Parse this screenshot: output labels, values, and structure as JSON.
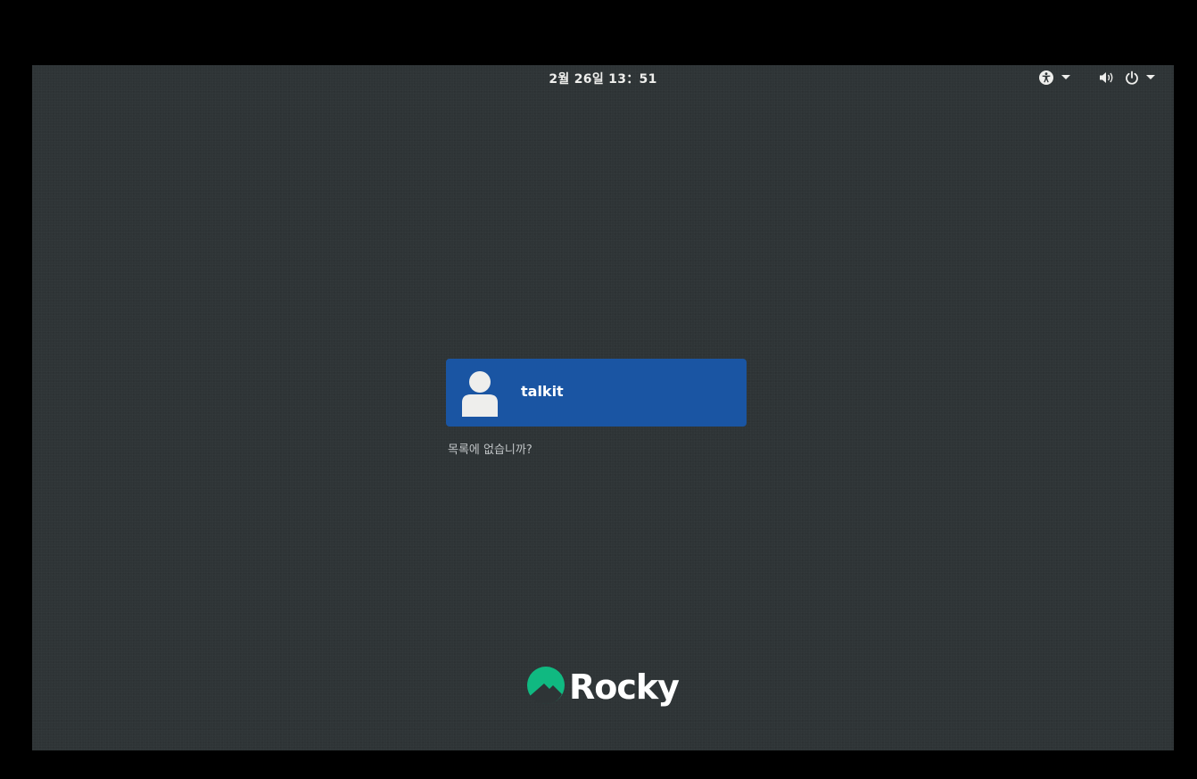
{
  "topbar": {
    "clock": "2월 26일 13：51",
    "icons": {
      "accessibility": "accessibility-icon",
      "volume": "volume-icon",
      "power": "power-icon",
      "dropdown": "chevron-down-icon"
    }
  },
  "user_list": {
    "users": [
      {
        "name": "talkit",
        "avatar": "user-avatar-icon"
      }
    ],
    "not_listed_label": "목록에 없습니까?"
  },
  "branding": {
    "logo_text": "Rocky",
    "logo_color": "#10b981"
  },
  "colors": {
    "background": "#2e3436",
    "selected_user": "#1a55a3",
    "text": "#eeeeec"
  }
}
